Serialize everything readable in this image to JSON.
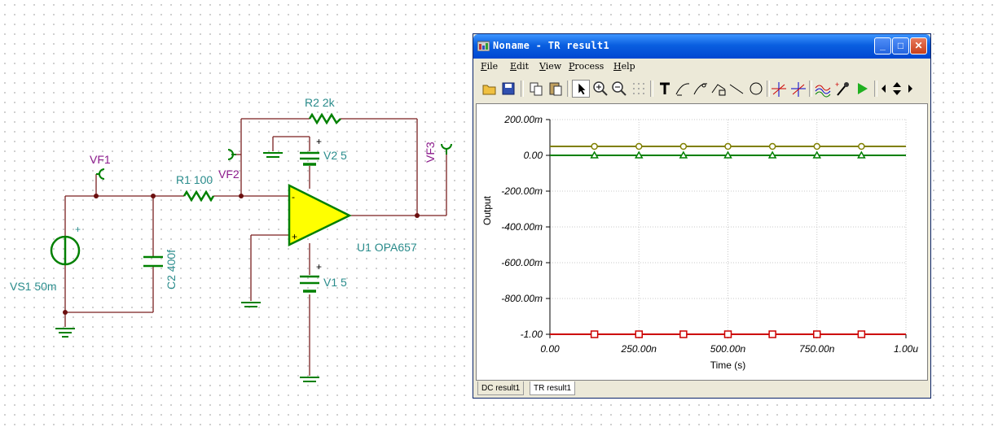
{
  "schematic": {
    "components": {
      "vs1": "VS1 50m",
      "c2": "C2 400f",
      "r1": "R1 100",
      "r2": "R2 2k",
      "v2": "V2 5",
      "v1": "V1 5",
      "u1": "U1 OPA657",
      "vf1": "VF1",
      "vf2": "VF2",
      "vf3": "VF3"
    },
    "symbols": {
      "plus": "+",
      "minus": "-"
    }
  },
  "window": {
    "title": "Noname - TR result1",
    "controls": {
      "minimize": "_",
      "maximize": "□",
      "close": "✕"
    },
    "menu": [
      "File",
      "Edit",
      "View",
      "Process",
      "Help"
    ],
    "toolbar": [
      "open-icon",
      "save-icon",
      "copy-icon",
      "paste-icon",
      "pointer-icon",
      "zoom-in-icon",
      "zoom-out-icon",
      "grid-icon",
      "text-icon",
      "curve-a-icon",
      "curve-b-icon",
      "curve-c-icon",
      "line-icon",
      "ellipse-icon",
      "cursor-a-icon",
      "cursor-b-icon",
      "wave-icon",
      "probe-icon",
      "run-icon",
      "scroll-left-icon",
      "scroll-updown-icon",
      "scroll-right-icon"
    ],
    "tabs": [
      {
        "label": "DC result1",
        "active": false
      },
      {
        "label": "TR result1",
        "active": true
      }
    ]
  },
  "chart_data": {
    "type": "line",
    "xlabel": "Time (s)",
    "ylabel": "Output",
    "xlim": [
      0,
      1.0
    ],
    "ylim": [
      -1.0,
      0.2
    ],
    "x_ticks": [
      "0.00",
      "250.00n",
      "500.00n",
      "750.00n",
      "1.00u"
    ],
    "y_ticks": [
      "200.00m",
      "0.00",
      "-200.00m",
      "-400.00m",
      "-600.00m",
      "-800.00m",
      "-1.00"
    ],
    "grid": true,
    "series": [
      {
        "marker": "circle",
        "color": "#808000",
        "x": [
          0,
          0.125,
          0.25,
          0.375,
          0.5,
          0.625,
          0.75,
          0.875,
          1.0
        ],
        "values": [
          0.05,
          0.05,
          0.05,
          0.05,
          0.05,
          0.05,
          0.05,
          0.05,
          0.05
        ]
      },
      {
        "marker": "triangle",
        "color": "#008000",
        "x": [
          0,
          0.125,
          0.25,
          0.375,
          0.5,
          0.625,
          0.75,
          0.875,
          1.0
        ],
        "values": [
          0,
          0,
          0,
          0,
          0,
          0,
          0,
          0,
          0
        ]
      },
      {
        "marker": "square",
        "color": "#cc0000",
        "x": [
          0,
          0.125,
          0.25,
          0.375,
          0.5,
          0.625,
          0.75,
          0.875,
          1.0
        ],
        "values": [
          -1.0,
          -1.0,
          -1.0,
          -1.0,
          -1.0,
          -1.0,
          -1.0,
          -1.0,
          -1.0
        ]
      }
    ]
  }
}
